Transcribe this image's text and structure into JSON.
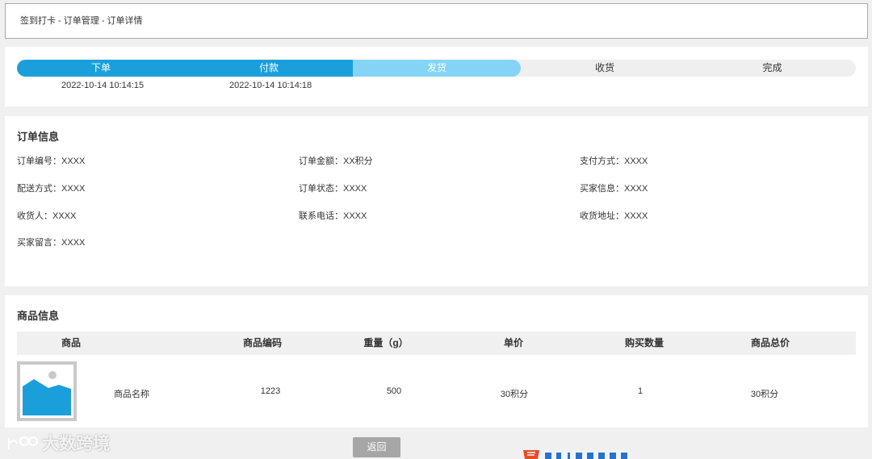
{
  "breadcrumb": "签到打卡 - 订单管理 - 订单详情",
  "progress": {
    "steps": [
      {
        "label": "下单",
        "time": "2022-10-14 10:14:15",
        "state": "done"
      },
      {
        "label": "付款",
        "time": "2022-10-14 10:14:18",
        "state": "done"
      },
      {
        "label": "发货",
        "time": "",
        "state": "current"
      },
      {
        "label": "收货",
        "time": "",
        "state": "pending"
      },
      {
        "label": "完成",
        "time": "",
        "state": "pending"
      }
    ]
  },
  "order": {
    "title": "订单信息",
    "fields": [
      "订单编号：XXXX",
      "订单金额：XX积分",
      "支付方式：XXXX",
      "配送方式：XXXX",
      "订单状态：XXXX",
      "买家信息：XXXX",
      "收货人：XXXX",
      "联系电话：XXXX",
      "收货地址：XXXX",
      "买家留言：XXXX"
    ]
  },
  "goods": {
    "title": "商品信息",
    "headers": [
      "商品",
      "商品编码",
      "重量（g）",
      "单价",
      "购买数量",
      "商品总价"
    ],
    "rows": [
      {
        "name": "商品名称",
        "code": "1223",
        "weight": "500",
        "price": "30积分",
        "qty": "1",
        "total": "30积分"
      }
    ]
  },
  "back_label": "返回",
  "watermark_text": "大数跨境",
  "colors": {
    "done": "#1a9fdb",
    "current": "#86d4f5",
    "pending": "#efefef",
    "button": "#a6a6a6"
  }
}
